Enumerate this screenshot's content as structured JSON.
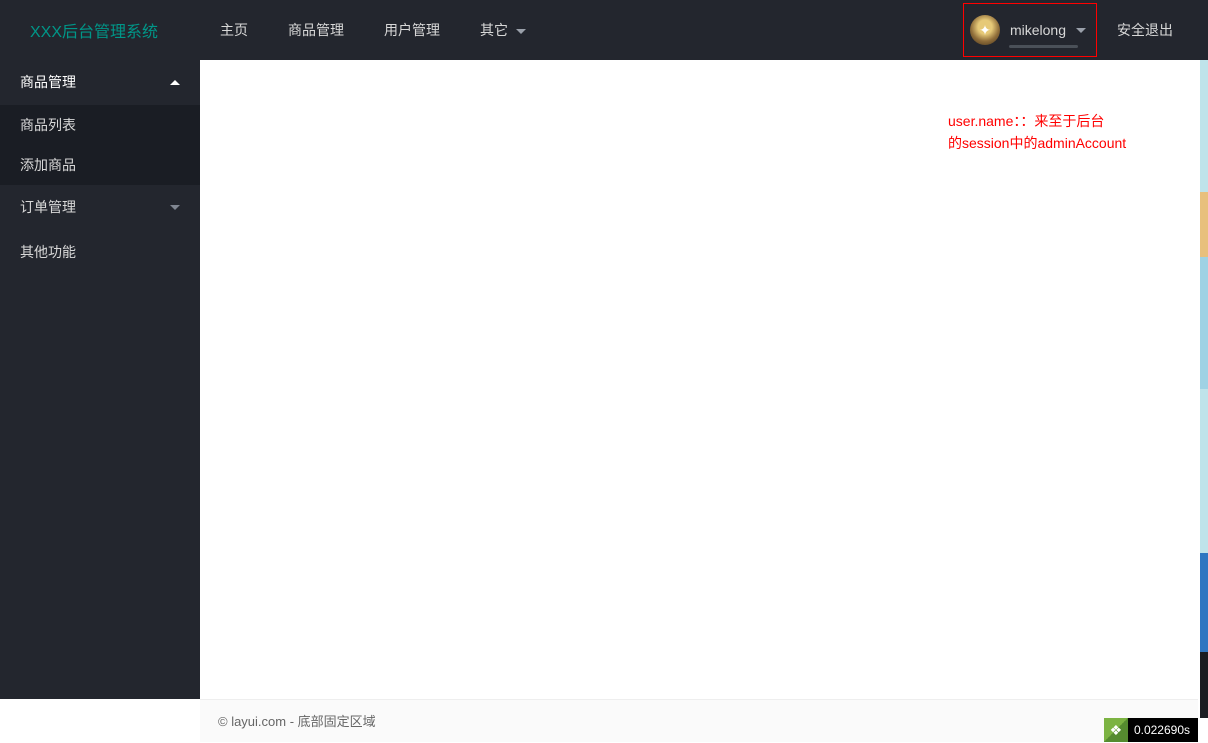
{
  "header": {
    "logo": "XXX后台管理系统",
    "nav": [
      "主页",
      "商品管理",
      "用户管理",
      "其它"
    ],
    "username": "mikelong",
    "logout": "安全退出"
  },
  "sidebar": {
    "groups": [
      {
        "label": "商品管理",
        "expanded": true,
        "children": [
          "商品列表",
          "添加商品"
        ]
      },
      {
        "label": "订单管理",
        "expanded": false,
        "children": []
      },
      {
        "label": "其他功能",
        "expanded": false,
        "children": []
      }
    ]
  },
  "content": {
    "annotation_line1": "user.name：：来至于后台",
    "annotation_line2": "的session中的adminAccount"
  },
  "footer": {
    "text": "© layui.com - 底部固定区域"
  },
  "perf": {
    "value": "0.022690s"
  },
  "colors": {
    "accent": "#009688",
    "header_bg": "#23262E",
    "highlight": "#ff0000"
  }
}
